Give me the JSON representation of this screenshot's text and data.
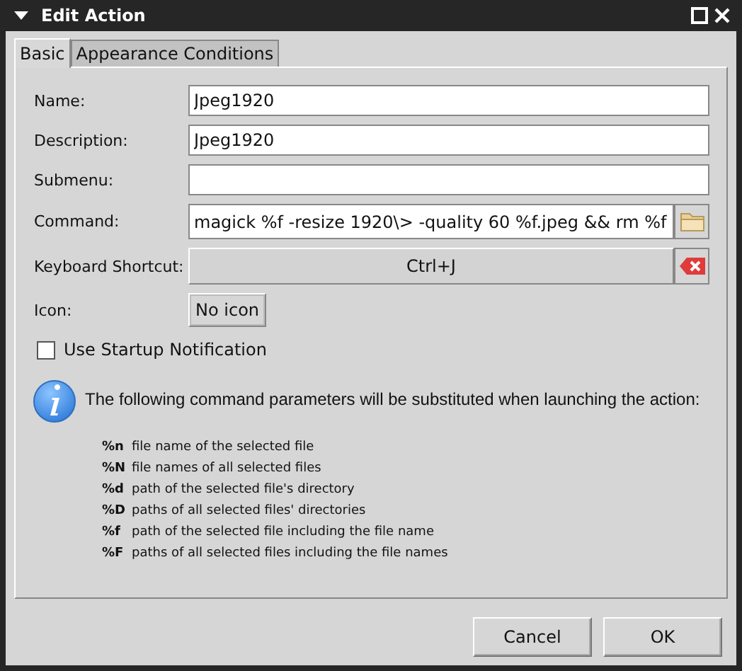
{
  "window": {
    "title": "Edit Action"
  },
  "tabs": [
    {
      "label": "Basic",
      "selected": true
    },
    {
      "label": "Appearance Conditions",
      "selected": false
    }
  ],
  "fields": [
    {
      "kind": "text",
      "label": "Name:",
      "value": "Jpeg1920"
    },
    {
      "kind": "text",
      "label": "Description:",
      "value": "Jpeg1920"
    },
    {
      "kind": "text",
      "label": "Submenu:"
    },
    {
      "kind": "command",
      "label": "Command:",
      "value": "magick %f -resize 1920\\> -quality 60 %f.jpeg && rm %f"
    },
    {
      "kind": "shortcut",
      "label": "Keyboard Shortcut:",
      "value": "Ctrl+J"
    },
    {
      "kind": "icon",
      "label": "Icon:",
      "value": "No icon"
    }
  ],
  "startup_notification": {
    "label": "Use Startup Notification",
    "checked": false
  },
  "info": {
    "text": "The following command parameters will be substituted when launching the action:",
    "parameters": [
      {
        "code": "%n",
        "description": "file name of the selected file"
      },
      {
        "code": "%N",
        "description": "file names of all selected files"
      },
      {
        "code": "%d",
        "description": "path of the selected file's directory"
      },
      {
        "code": "%D",
        "description": "paths of all selected files' directories"
      },
      {
        "code": "%f",
        "description": "path of the selected file including the file name"
      },
      {
        "code": "%F",
        "description": "paths of all selected files including the file names"
      }
    ]
  },
  "buttons": [
    "Cancel",
    "OK"
  ]
}
